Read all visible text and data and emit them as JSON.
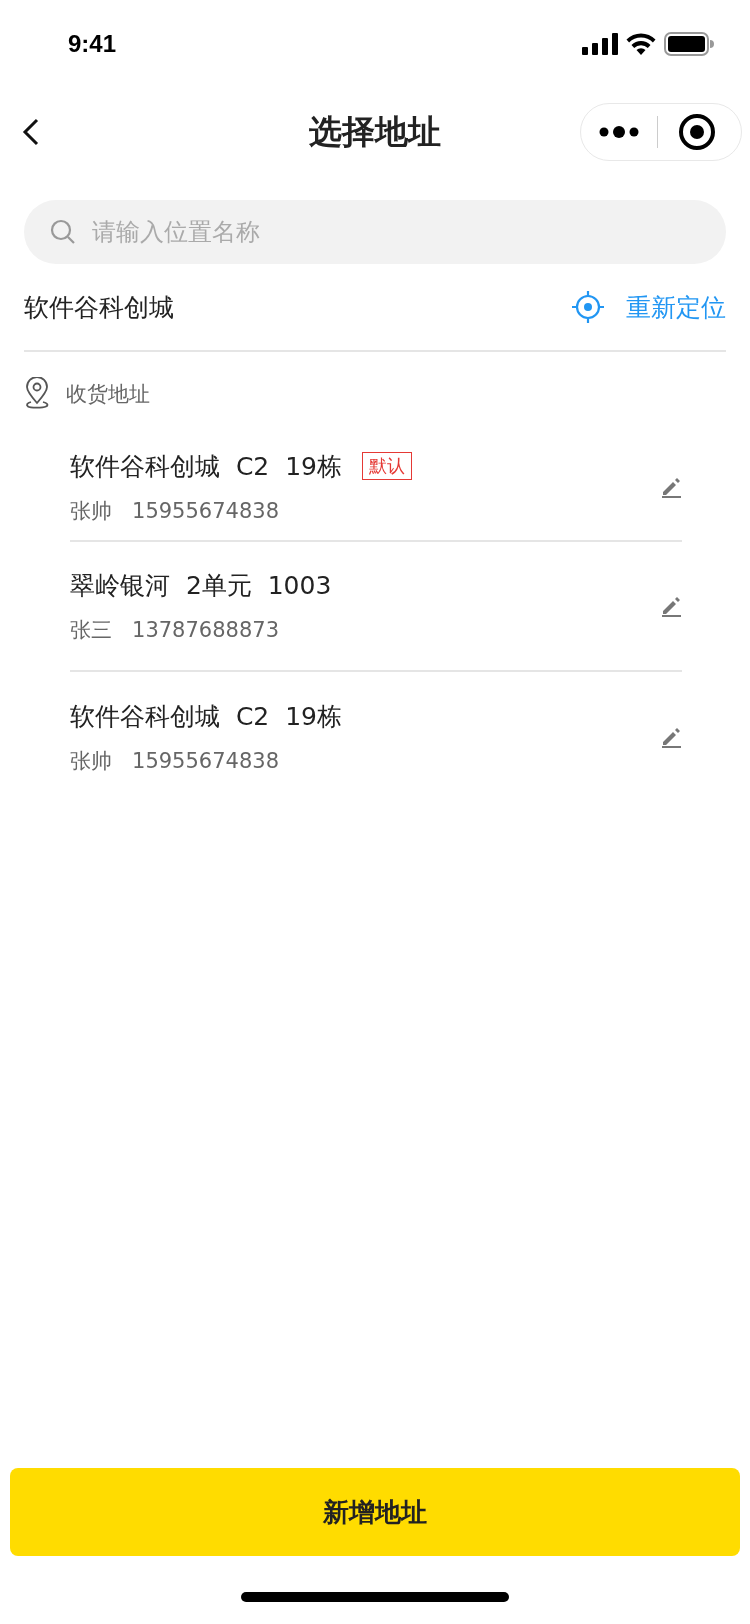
{
  "status_bar": {
    "time": "9:41"
  },
  "nav": {
    "title": "选择地址"
  },
  "search": {
    "placeholder": "请输入位置名称"
  },
  "location": {
    "name": "软件谷科创城",
    "relocate": "重新定位"
  },
  "section": {
    "title": "收货地址"
  },
  "addresses": [
    {
      "address": "软件谷科创城  C2  19栋",
      "badge": "默认",
      "contact": "张帅   15955674838"
    },
    {
      "address": "翠岭银河  2单元  1003",
      "contact": "张三   13787688873"
    },
    {
      "address": "软件谷科创城  C2  19栋",
      "contact": "张帅   15955674838"
    }
  ],
  "add_button": "新增地址"
}
